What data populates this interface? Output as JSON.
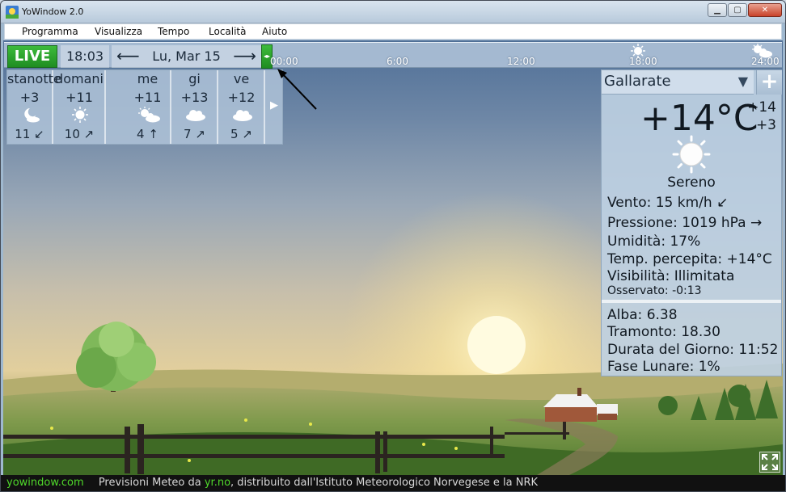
{
  "window": {
    "title": "YoWindow 2.0",
    "min_label": "▁",
    "max_label": "▢",
    "close_label": "✕"
  },
  "menu": [
    "Programma",
    "Visualizza",
    "Tempo",
    "Località",
    "Aiuto"
  ],
  "timebar": {
    "live_label": "LIVE",
    "time": "18:03",
    "date": "Lu, Mar 15",
    "prev_icon": "⟵",
    "next_icon": "⟶",
    "slider_glyph": "◂▸",
    "ticks": [
      "00:00",
      "6:00",
      "12:00",
      "18:00",
      "24:00"
    ],
    "tick_icons": [
      "sun-icon",
      "partly-cloudy-icon"
    ]
  },
  "forecast": [
    {
      "name": "stanotte",
      "temp": "+3",
      "icon": "moon-cloud-icon",
      "wind": "11 ↙"
    },
    {
      "name": "domani",
      "temp": "+11",
      "icon": "sun-icon",
      "wind": "10 ↗"
    },
    {
      "name": "me",
      "temp": "+11",
      "icon": "partly-cloudy-icon",
      "wind": "4 ↑"
    },
    {
      "name": "gi",
      "temp": "+13",
      "icon": "cloud-icon",
      "wind": "7 ↗"
    },
    {
      "name": "ve",
      "temp": "+12",
      "icon": "cloud-icon",
      "wind": "5 ↗"
    }
  ],
  "forecast_next": "▶",
  "current": {
    "location": "Gallarate",
    "dropdown": "▼",
    "add": "+",
    "temp": "+14°C",
    "hi": "+14",
    "lo": "+3",
    "condition": "Sereno",
    "wind": "Vento:  15 km/h  ↙",
    "pressure": "Pressione:  1019 hPa  →",
    "humidity": "Umidità:  17%",
    "feels": "Temp. percepita:  +14°C",
    "visibility": "Visibilità:  Illimitata",
    "observed": "Osservato:  -0:13",
    "sunrise": "Alba:  6.38",
    "sunset": "Tramonto:  18.30",
    "daylength": "Durata del Giorno:  11:52",
    "moon": "Fase Lunare:  1%"
  },
  "footer": {
    "site": "yowindow.com",
    "text1": "Previsioni Meteo da ",
    "provider": "yr.no",
    "text2": ", distribuito dall'Istituto Meteorologico Norvegese e la NRK"
  },
  "colors": {
    "live": "#2aa52c",
    "panel": "#bed0e2",
    "footer_link": "#4fd82a"
  }
}
